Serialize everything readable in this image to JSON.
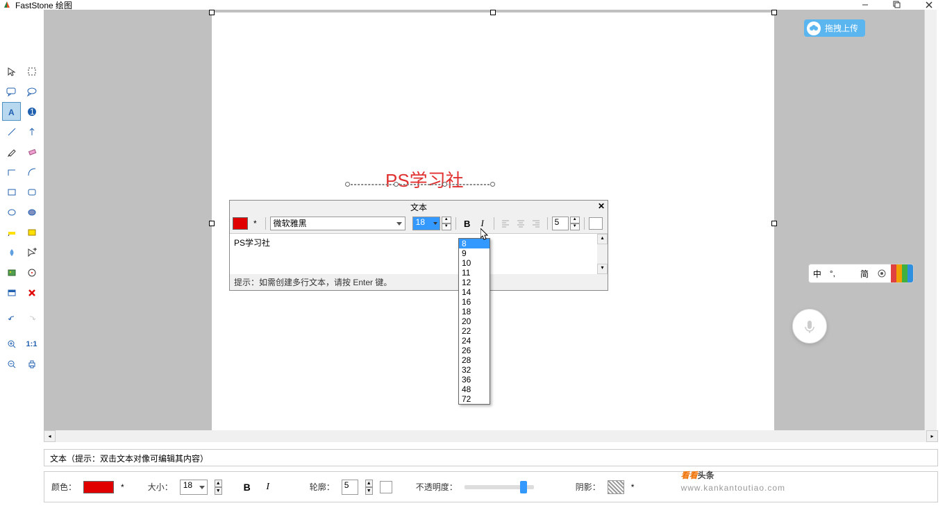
{
  "window": {
    "title": "FastStone 绘图"
  },
  "upload_badge": "拖拽上传",
  "canvas_text": "PS学习社",
  "text_dialog": {
    "title": "文本",
    "font": "微软雅黑",
    "size": "18",
    "spacing": "5",
    "content": "PS学习社",
    "hint": "提示：如需创建多行文本，请按 Enter 键。",
    "asterisk": "*"
  },
  "size_options": [
    "8",
    "9",
    "10",
    "11",
    "12",
    "14",
    "16",
    "18",
    "20",
    "22",
    "24",
    "26",
    "28",
    "32",
    "36",
    "48",
    "72"
  ],
  "size_selected_index": 0,
  "bottom_status": "文本（提示：双击文本对像可编辑其内容）",
  "bottom_toolbar": {
    "color_label": "颜色：",
    "asterisk": "*",
    "size_label": "大小：",
    "size_value": "18",
    "outline_label": "轮廓：",
    "outline_value": "5",
    "opacity_label": "不透明度：",
    "opacity_percent": 80,
    "shadow_label": "阴影：",
    "shadow_asterisk": "*"
  },
  "ime": {
    "lang": "中",
    "mode": "简"
  },
  "watermark": {
    "line1_a": "看看",
    "line1_b": "头条",
    "url": "www.kankantoutiao.com"
  },
  "colors": {
    "red": "#e00000",
    "blue": "#3399ff"
  }
}
